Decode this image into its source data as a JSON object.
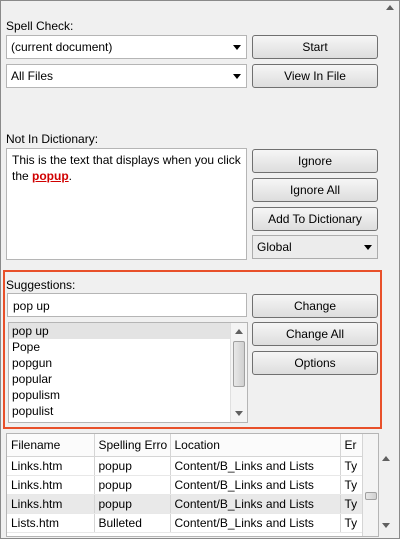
{
  "spell_check": {
    "label": "Spell Check:",
    "scope_combo": "(current document)",
    "files_combo": "All Files",
    "start_button": "Start",
    "view_in_file_button": "View In File"
  },
  "not_in_dictionary": {
    "label": "Not In Dictionary:",
    "text_before": "This is the text that displays when you click the ",
    "misspelled_word": "popup",
    "text_after": ".",
    "ignore_button": "Ignore",
    "ignore_all_button": "Ignore All",
    "add_to_dictionary_button": "Add To Dictionary",
    "dictionary_combo": "Global"
  },
  "suggestions": {
    "label": "Suggestions:",
    "input_value": "pop up",
    "items": [
      "pop up",
      "Pope",
      "popgun",
      "popular",
      "populism",
      "populist"
    ],
    "change_button": "Change",
    "change_all_button": "Change All",
    "options_button": "Options"
  },
  "results": {
    "columns": [
      "Filename",
      "Spelling Erro",
      "Location",
      "Er"
    ],
    "rows": [
      [
        "Links.htm",
        "popup",
        "Content/B_Links and Lists",
        "Ty"
      ],
      [
        "Links.htm",
        "popup",
        "Content/B_Links and Lists",
        "Ty"
      ],
      [
        "Links.htm",
        "popup",
        "Content/B_Links and Lists",
        "Ty"
      ],
      [
        "Lists.htm",
        "Bulleted",
        "Content/B_Links and Lists",
        "Ty"
      ]
    ]
  },
  "colors": {
    "highlight_border": "#e8502a",
    "misspelled": "#d00000"
  }
}
